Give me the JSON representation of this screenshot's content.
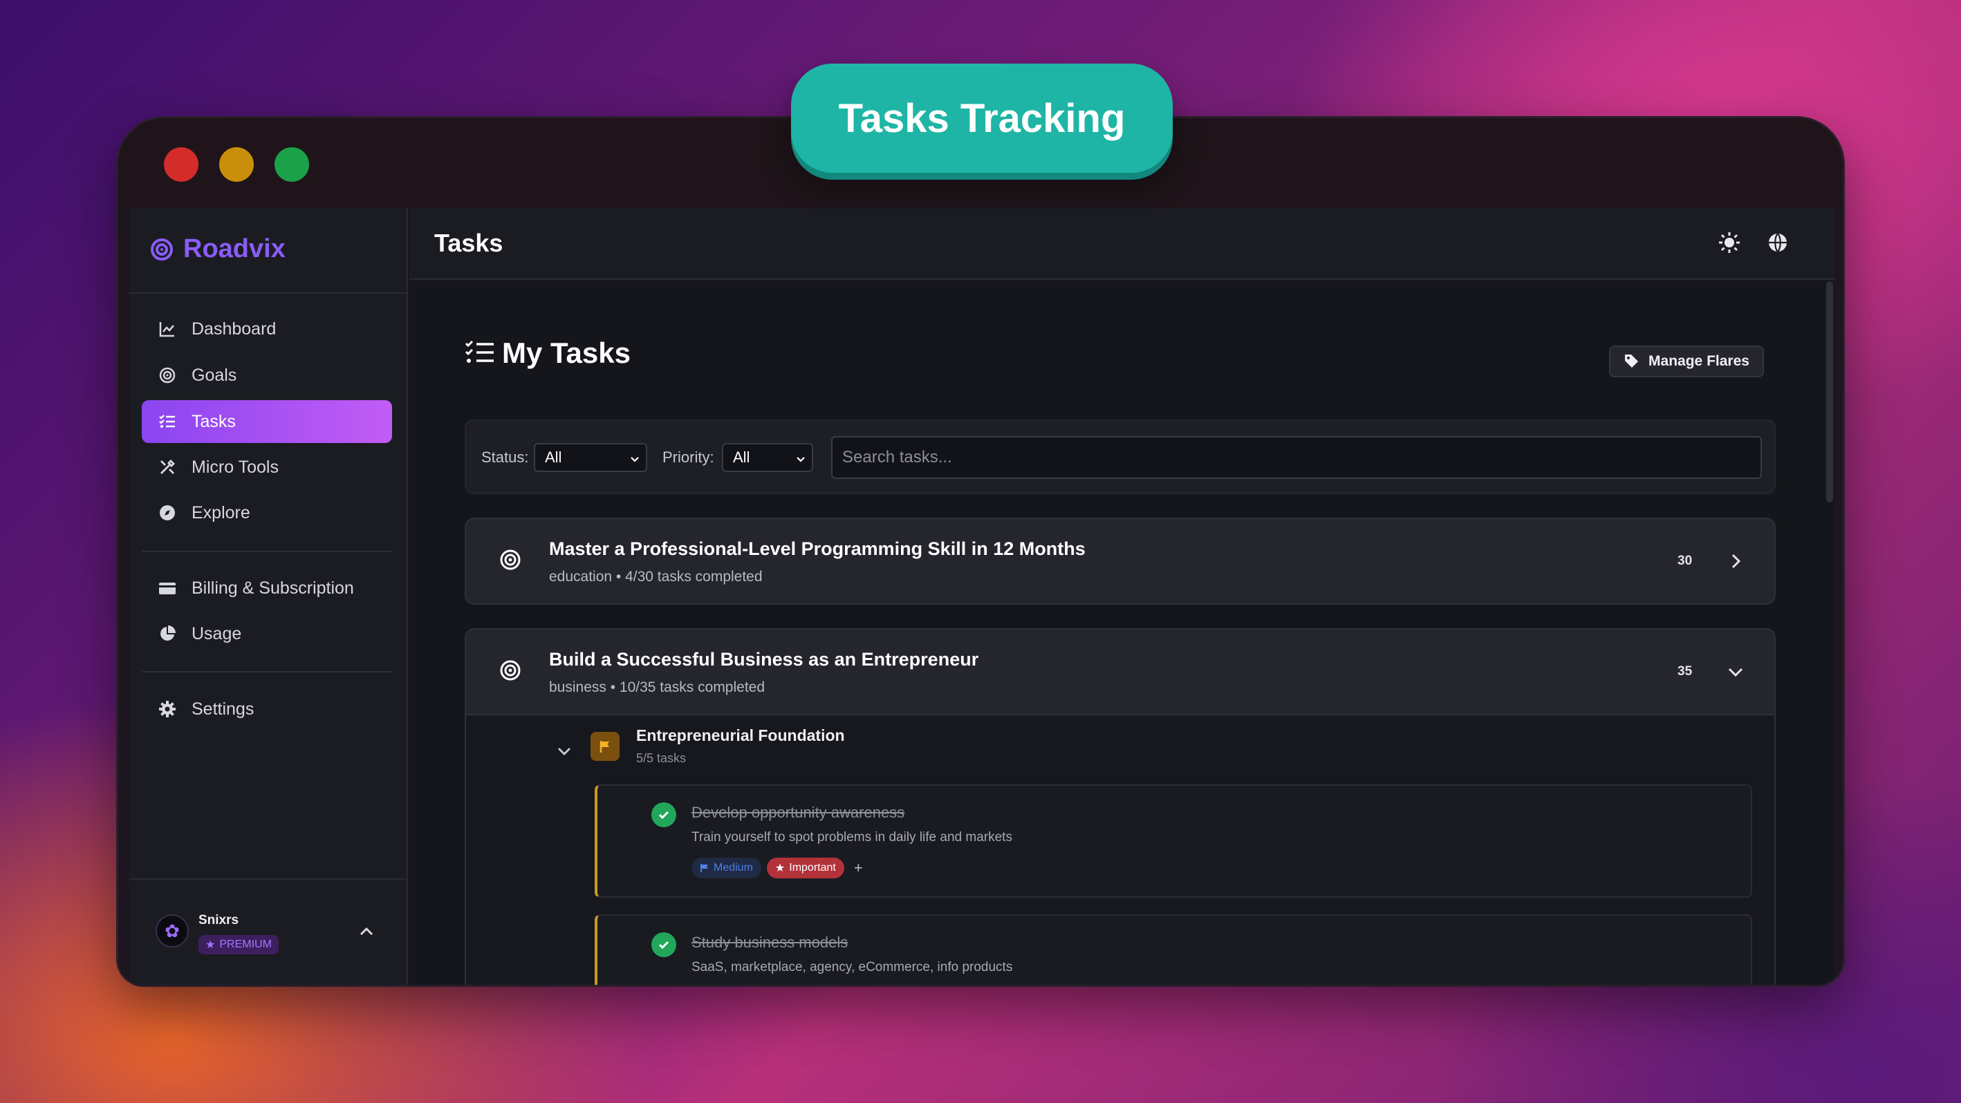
{
  "banner": {
    "label": "Tasks Tracking"
  },
  "brand": {
    "name": "Roadvix"
  },
  "sidebar": {
    "items": [
      {
        "label": "Dashboard",
        "icon": "chart-line-icon"
      },
      {
        "label": "Goals",
        "icon": "target-icon"
      },
      {
        "label": "Tasks",
        "icon": "task-list-icon",
        "active": true
      },
      {
        "label": "Micro Tools",
        "icon": "tools-icon"
      },
      {
        "label": "Explore",
        "icon": "compass-icon"
      },
      {
        "label": "Billing & Subscription",
        "icon": "credit-card-icon"
      },
      {
        "label": "Usage",
        "icon": "pie-chart-icon"
      },
      {
        "label": "Settings",
        "icon": "gear-icon"
      }
    ]
  },
  "user": {
    "name": "Snixrs",
    "plan": "PREMIUM"
  },
  "topbar": {
    "title": "Tasks",
    "icons": [
      "sun-icon",
      "globe-icon"
    ]
  },
  "main": {
    "heading": "My Tasks",
    "manage_label": "Manage Flares",
    "filters": {
      "status_label": "Status:",
      "status_value": "All",
      "priority_label": "Priority:",
      "priority_value": "All",
      "search_placeholder": "Search tasks..."
    },
    "goals": [
      {
        "title": "Master a Professional-Level Programming Skill in 12 Months",
        "subtitle": "education • 4/30 tasks completed",
        "count": "30",
        "expanded": false
      },
      {
        "title": "Build a Successful Business as an Entrepreneur",
        "subtitle": "business • 10/35 tasks completed",
        "count": "35",
        "expanded": true,
        "milestone": {
          "title": "Entrepreneurial Foundation",
          "subtitle": "5/5 tasks",
          "tasks": [
            {
              "title": "Develop opportunity awareness",
              "description": "Train yourself to spot problems in daily life and markets",
              "tags": [
                "Medium",
                "Important"
              ],
              "add_label": "+"
            },
            {
              "title": "Study business models",
              "description": "SaaS, marketplace, agency, eCommerce, info products"
            }
          ]
        }
      }
    ]
  },
  "colors": {
    "accent": "#8b5cf6",
    "banner": "#1fb5a6",
    "done": "#22a75a",
    "milestone_border": "#c99a1e"
  }
}
